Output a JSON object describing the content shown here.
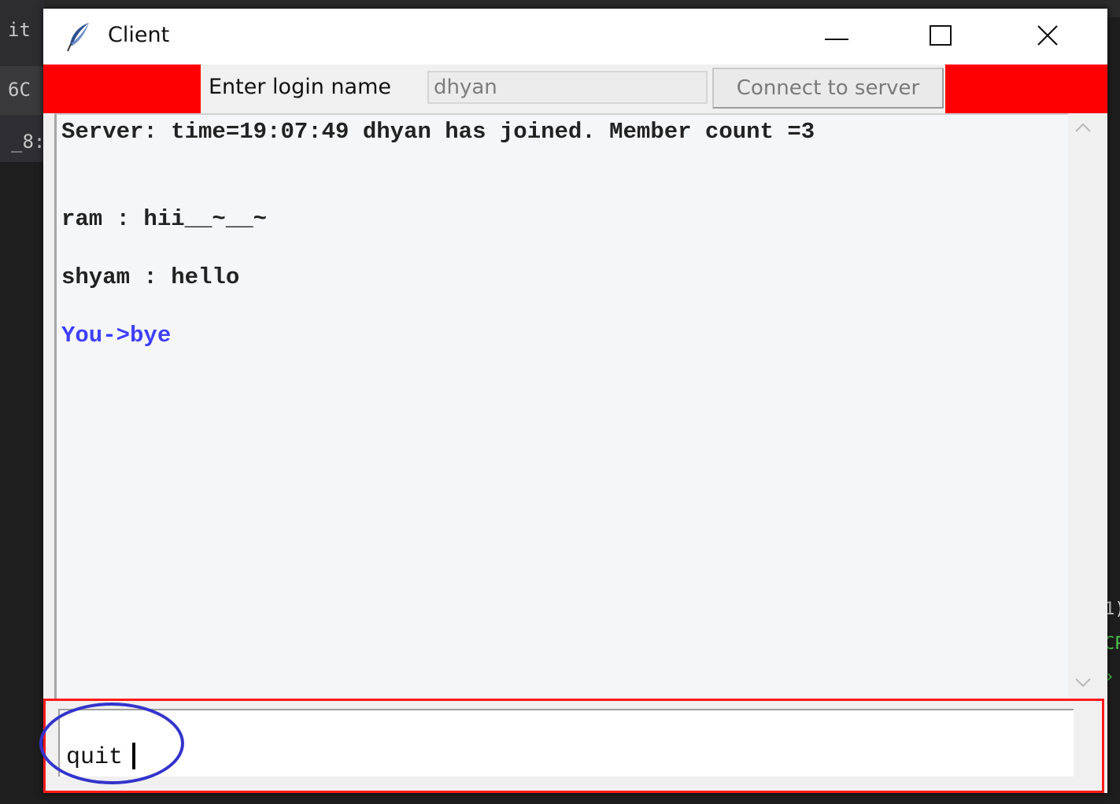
{
  "background": {
    "left_fragments": [
      "it",
      "6C",
      "_8:"
    ],
    "right_fragments": [
      "1)",
      "CP",
      "›"
    ]
  },
  "window": {
    "title": "Client",
    "icon": "feather-icon",
    "controls": [
      "minimize-icon",
      "maximize-icon",
      "close-icon"
    ],
    "accent_color": "#ff0000"
  },
  "login": {
    "label": "Enter login name",
    "name_value": "dhyan",
    "connect_label": "Connect to server"
  },
  "chat": {
    "messages": [
      {
        "text": "Server: time=19:07:49 dhyan has joined. Member count =3",
        "sender": "server"
      },
      {
        "text": "ram : hii__~__~",
        "sender": "other"
      },
      {
        "text": "shyam : hello",
        "sender": "other"
      },
      {
        "text": "You->bye",
        "sender": "self",
        "color": "#3f3fff"
      }
    ]
  },
  "entry": {
    "value": "quit",
    "annotation_color": "#3333cc"
  }
}
